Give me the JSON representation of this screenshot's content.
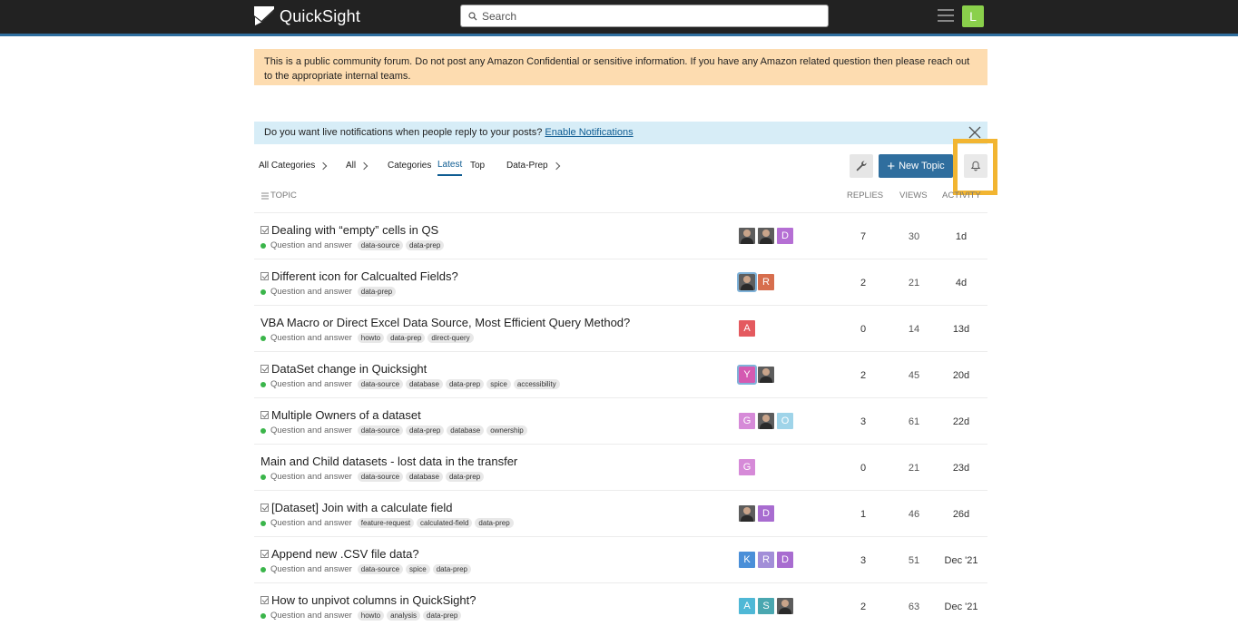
{
  "header": {
    "brand": "QuickSight",
    "search_placeholder": "Search",
    "user_initial": "L"
  },
  "banner_text": "This is a public community forum. Do not post any Amazon Confidential or sensitive information. If you have any Amazon related question then please reach out to the appropriate internal teams.",
  "notification": {
    "text": "Do you want live notifications when people reply to your posts?",
    "link": "Enable Notifications"
  },
  "nav": {
    "all_categories": "All Categories",
    "all": "All",
    "categories": "Categories",
    "latest": "Latest",
    "top": "Top",
    "data_prep": "Data-Prep",
    "new_topic": "New Topic"
  },
  "columns": {
    "topic": "TOPIC",
    "replies": "REPLIES",
    "views": "VIEWS",
    "activity": "ACTIVITY"
  },
  "colors": {
    "header_bg": "#222222",
    "accent": "#2f6e9e",
    "banner_bg": "#fddcb0",
    "notify_bg": "#d7edf7",
    "highlight": "#f2b531",
    "category_dot": "#3ab54a"
  },
  "topics": [
    {
      "title": "Dealing with “empty” cells in QS",
      "solved": true,
      "category": "Question and answer",
      "tags": [
        "data-source",
        "data-prep"
      ],
      "posters": [
        {
          "type": "photo"
        },
        {
          "type": "photo"
        },
        {
          "type": "letter",
          "letter": "D",
          "color": "#b56fd4"
        }
      ],
      "replies": "7",
      "views": "30",
      "activity": "1d"
    },
    {
      "title": "Different icon for Calcualted Fields?",
      "solved": true,
      "category": "Question and answer",
      "tags": [
        "data-prep"
      ],
      "posters": [
        {
          "type": "photo",
          "ring": true
        },
        {
          "type": "letter",
          "letter": "R",
          "color": "#d76e4d"
        }
      ],
      "replies": "2",
      "views": "21",
      "activity": "4d"
    },
    {
      "title": "VBA Macro or Direct Excel Data Source, Most Efficient Query Method?",
      "solved": false,
      "category": "Question and answer",
      "tags": [
        "howto",
        "data-prep",
        "direct-query"
      ],
      "posters": [
        {
          "type": "letter",
          "letter": "A",
          "color": "#e45a5f"
        }
      ],
      "replies": "0",
      "views": "14",
      "activity": "13d"
    },
    {
      "title": "DataSet change in Quicksight",
      "solved": true,
      "category": "Question and answer",
      "tags": [
        "data-source",
        "database",
        "data-prep",
        "spice",
        "accessibility"
      ],
      "posters": [
        {
          "type": "letter",
          "letter": "Y",
          "color": "#d45ab1",
          "ring": true
        },
        {
          "type": "photo"
        }
      ],
      "replies": "2",
      "views": "45",
      "activity": "20d"
    },
    {
      "title": "Multiple Owners of a dataset",
      "solved": true,
      "category": "Question and answer",
      "tags": [
        "data-source",
        "data-prep",
        "database",
        "ownership"
      ],
      "posters": [
        {
          "type": "letter",
          "letter": "G",
          "color": "#d68ad8"
        },
        {
          "type": "photo"
        },
        {
          "type": "letter",
          "letter": "O",
          "color": "#9fd4e9"
        }
      ],
      "replies": "3",
      "views": "61",
      "activity": "22d"
    },
    {
      "title": "Main and Child datasets - lost data in the transfer",
      "solved": false,
      "category": "Question and answer",
      "tags": [
        "data-source",
        "database",
        "data-prep"
      ],
      "posters": [
        {
          "type": "letter",
          "letter": "G",
          "color": "#d68ad8"
        }
      ],
      "replies": "0",
      "views": "21",
      "activity": "23d"
    },
    {
      "title": "[Dataset] Join with a calculate field",
      "solved": true,
      "category": "Question and answer",
      "tags": [
        "feature-request",
        "calculated-field",
        "data-prep"
      ],
      "posters": [
        {
          "type": "photo"
        },
        {
          "type": "letter",
          "letter": "D",
          "color": "#a86cd0"
        }
      ],
      "replies": "1",
      "views": "46",
      "activity": "26d"
    },
    {
      "title": "Append new .CSV file data?",
      "solved": true,
      "category": "Question and answer",
      "tags": [
        "data-source",
        "spice",
        "data-prep"
      ],
      "posters": [
        {
          "type": "letter",
          "letter": "K",
          "color": "#4a8fd8"
        },
        {
          "type": "letter",
          "letter": "R",
          "color": "#a28ed8"
        },
        {
          "type": "letter",
          "letter": "D",
          "color": "#a86cd0"
        }
      ],
      "replies": "3",
      "views": "51",
      "activity": "Dec '21"
    },
    {
      "title": "How to unpivot columns in QuickSight?",
      "solved": true,
      "category": "Question and answer",
      "tags": [
        "howto",
        "analysis",
        "data-prep"
      ],
      "posters": [
        {
          "type": "letter",
          "letter": "A",
          "color": "#4fb8d6"
        },
        {
          "type": "letter",
          "letter": "S",
          "color": "#4aa7b0"
        },
        {
          "type": "photo"
        }
      ],
      "replies": "2",
      "views": "63",
      "activity": "Dec '21"
    }
  ]
}
